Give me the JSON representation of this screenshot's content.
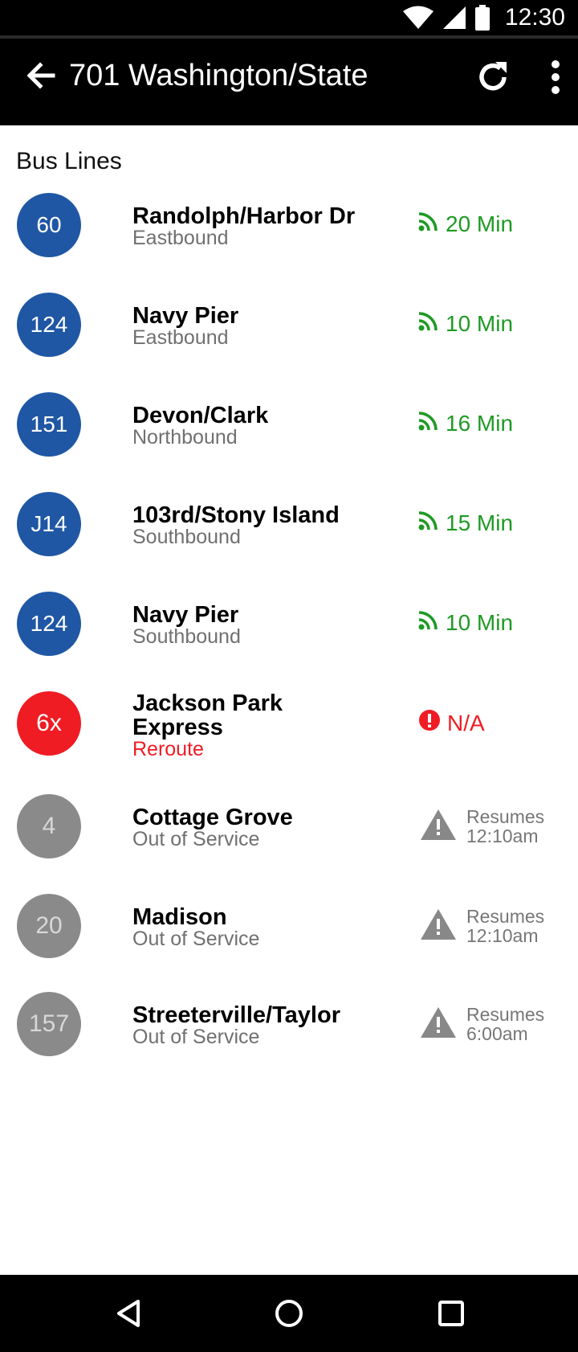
{
  "status_bar": {
    "time": "12:30",
    "icons": [
      "wifi-icon",
      "cell-signal-icon",
      "battery-icon"
    ]
  },
  "app_bar": {
    "title": "701 Washington/State",
    "back_icon": "arrow-back-icon",
    "refresh_icon": "refresh-icon",
    "more_icon": "more-vert-icon"
  },
  "section_title": "Bus Lines",
  "colors": {
    "route_blue": "#1f57a4",
    "alert_red": "#ef1c24",
    "out_of_service_grey": "#8a8a8a",
    "eta_green": "#1f9a24"
  },
  "routes": [
    {
      "number": "60",
      "name": "Randolph/Harbor Dr",
      "direction": "Eastbound",
      "eta": "20 Min",
      "status": "live"
    },
    {
      "number": "124",
      "name": "Navy Pier",
      "direction": "Eastbound",
      "eta": "10 Min",
      "status": "live"
    },
    {
      "number": "151",
      "name": "Devon/Clark",
      "direction": "Northbound",
      "eta": "16 Min",
      "status": "live"
    },
    {
      "number": "J14",
      "name": "103rd/Stony Island",
      "direction": "Southbound",
      "eta": "15 Min",
      "status": "live"
    },
    {
      "number": "124",
      "name": "Navy Pier",
      "direction": "Southbound",
      "eta": "10 Min",
      "status": "live"
    },
    {
      "number": "6x",
      "name_line1": "Jackson Park",
      "name_line2": "Express",
      "direction": "Reroute",
      "eta": "N/A",
      "status": "reroute"
    },
    {
      "number": "4",
      "name": "Cottage Grove",
      "direction": "Out of Service",
      "resume_line1": "Resumes",
      "resume_line2": "12:10am",
      "status": "out"
    },
    {
      "number": "20",
      "name": "Madison",
      "direction": "Out of Service",
      "resume_line1": "Resumes",
      "resume_line2": "12:10am",
      "status": "out"
    },
    {
      "number": "157",
      "name": "Streeterville/Taylor",
      "direction": "Out of Service",
      "resume_line1": "Resumes",
      "resume_line2": "6:00am",
      "status": "out"
    }
  ],
  "nav_bar": {
    "icons": [
      "nav-back-icon",
      "nav-home-icon",
      "nav-recents-icon"
    ]
  }
}
